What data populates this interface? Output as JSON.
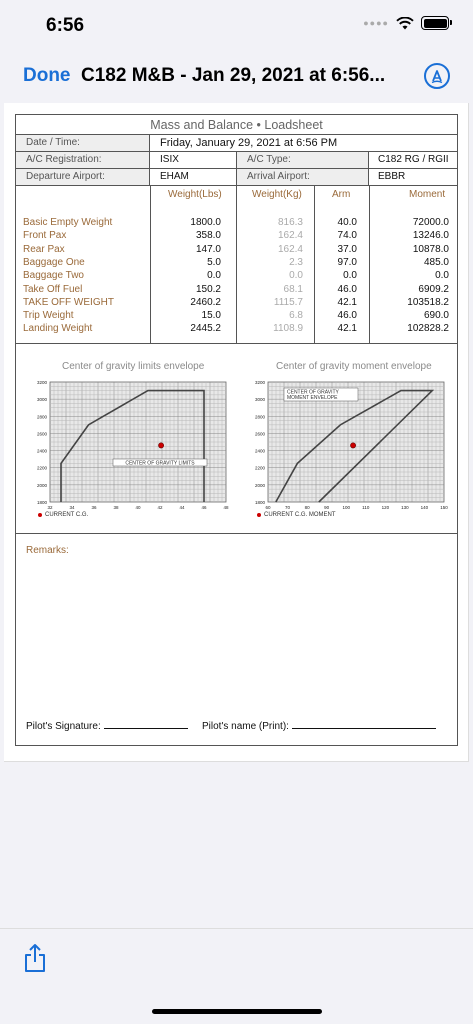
{
  "status_bar": {
    "time": "6:56"
  },
  "nav": {
    "done_label": "Done",
    "title": "C182 M&B - Jan 29, 2021 at 6:56..."
  },
  "sheet": {
    "title": "Mass and Balance • Loadsheet",
    "date_label": "Date / Time:",
    "date_value": "Friday, January 29, 2021 at 6:56 PM",
    "reg_label": "A/C Registration:",
    "reg_value": "ISIX",
    "type_label": "A/C Type:",
    "type_value": "C182 RG / RGII",
    "dep_label": "Departure Airport:",
    "dep_value": "EHAM",
    "arr_label": "Arrival Airport:",
    "arr_value": "EBBR"
  },
  "weights": {
    "headers": {
      "lbs": "Weight(Lbs)",
      "kg": "Weight(Kg)",
      "arm": "Arm",
      "moment": "Moment"
    },
    "rows": [
      {
        "name": "Basic Empty Weight",
        "lbs": "1800.0",
        "kg": "816.3",
        "arm": "40.0",
        "moment": "72000.0"
      },
      {
        "name": "Front Pax",
        "lbs": "358.0",
        "kg": "162.4",
        "arm": "74.0",
        "moment": "13246.0"
      },
      {
        "name": "Rear Pax",
        "lbs": "147.0",
        "kg": "162.4",
        "arm": "37.0",
        "moment": "10878.0"
      },
      {
        "name": "Baggage One",
        "lbs": "5.0",
        "kg": "2.3",
        "arm": "97.0",
        "moment": "485.0"
      },
      {
        "name": "Baggage Two",
        "lbs": "0.0",
        "kg": "0.0",
        "arm": "0.0",
        "moment": "0.0"
      },
      {
        "name": "Take Off Fuel",
        "lbs": "150.2",
        "kg": "68.1",
        "arm": "46.0",
        "moment": "6909.2"
      },
      {
        "name": "TAKE OFF WEIGHT",
        "lbs": "2460.2",
        "kg": "1115.7",
        "arm": "42.1",
        "moment": "103518.2"
      },
      {
        "name": "Trip Weight",
        "lbs": "15.0",
        "kg": "6.8",
        "arm": "46.0",
        "moment": "690.0"
      },
      {
        "name": "Landing Weight",
        "lbs": "2445.2",
        "kg": "1108.9",
        "arm": "42.1",
        "moment": "102828.2"
      }
    ]
  },
  "chart_data": [
    {
      "type": "line",
      "title": "Center of gravity limits envelope",
      "annotation": "CENTER OF GRAVITY LIMITS",
      "legend": "CURRENT C.G.",
      "xlim": [
        32,
        48
      ],
      "ylim": [
        1800,
        3200
      ],
      "x_ticks": [
        "32",
        "34",
        "36",
        "38",
        "40",
        "42",
        "44",
        "46",
        "48"
      ],
      "y_ticks": [
        "3200",
        "3000",
        "2800",
        "2600",
        "2400",
        "2200",
        "2000",
        "1800"
      ],
      "envelope": [
        {
          "x": 33.0,
          "y": 1800
        },
        {
          "x": 33.0,
          "y": 2250
        },
        {
          "x": 35.5,
          "y": 2700
        },
        {
          "x": 40.9,
          "y": 3100
        },
        {
          "x": 46.0,
          "y": 3100
        },
        {
          "x": 46.0,
          "y": 1800
        }
      ],
      "current_point": {
        "x": 42.1,
        "y": 2460
      },
      "point_color": "#cc0000"
    },
    {
      "type": "line",
      "title": "Center of gravity moment envelope",
      "annotation": "CENTER OF GRAVITY MOMENT ENVELOPE",
      "legend": "CURRENT C.G. MOMENT",
      "xlim": [
        60,
        150
      ],
      "ylim": [
        1800,
        3200
      ],
      "x_ticks": [
        "60",
        "70",
        "80",
        "90",
        "100",
        "110",
        "120",
        "130",
        "140",
        "150"
      ],
      "y_ticks": [
        "3200",
        "3000",
        "2800",
        "2600",
        "2400",
        "2200",
        "2000",
        "1800"
      ],
      "envelope": [
        {
          "x": 64,
          "y": 1800
        },
        {
          "x": 75,
          "y": 2250
        },
        {
          "x": 97,
          "y": 2700
        },
        {
          "x": 128,
          "y": 3100
        },
        {
          "x": 144,
          "y": 3100
        },
        {
          "x": 86,
          "y": 1800
        }
      ],
      "current_point": {
        "x": 103.5,
        "y": 2460
      },
      "point_color": "#cc0000"
    }
  ],
  "footer": {
    "remarks_label": "Remarks:",
    "signature_label": "Pilot's Signature:",
    "name_label": "Pilot's name (Print):"
  },
  "icons": {
    "share": "share-icon",
    "markup": "markup-icon",
    "wifi": "wifi-icon",
    "battery": "battery-icon"
  },
  "colors": {
    "accent": "#1a6fd6",
    "label": "#9a6a3a"
  }
}
